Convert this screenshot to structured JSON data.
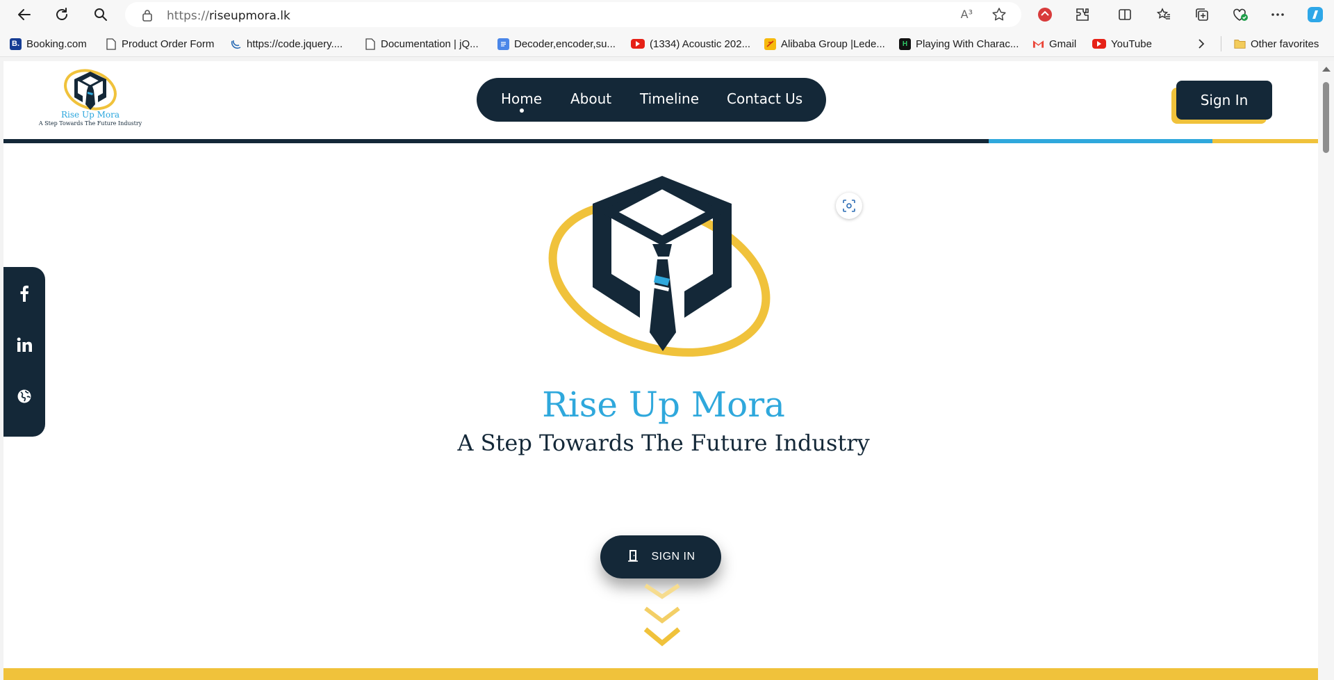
{
  "browser": {
    "url_protocol": "https://",
    "url_host": "riseupmora.lk",
    "read_aloud_label": "A³",
    "bookmarks": [
      {
        "label": "Booking.com",
        "icon": "booking-icon"
      },
      {
        "label": "Product Order Form",
        "icon": "page-icon"
      },
      {
        "label": "https://code.jquery....",
        "icon": "jquery-icon"
      },
      {
        "label": "Documentation | jQ...",
        "icon": "page-icon"
      },
      {
        "label": "Decoder,encoder,su...",
        "icon": "docs-icon"
      },
      {
        "label": "(1334) Acoustic 202...",
        "icon": "youtube-icon"
      },
      {
        "label": "Alibaba Group |Lede...",
        "icon": "alibaba-icon"
      },
      {
        "label": "Playing With Charac...",
        "icon": "hackerrank-icon"
      },
      {
        "label": "Gmail",
        "icon": "gmail-icon"
      },
      {
        "label": "YouTube",
        "icon": "youtube-icon"
      }
    ],
    "other_favorites": "Other favorites"
  },
  "site": {
    "logo_name": "Rise Up Mora",
    "logo_tagline": "A Step Towards The Future Industry",
    "nav": [
      "Home",
      "About",
      "Timeline",
      "Contact Us"
    ],
    "active_nav": "Home",
    "signin_label": "Sign In",
    "hero_title": "Rise Up Mora",
    "hero_subtitle": "A Step Towards The Future Industry",
    "cta_label": "SIGN IN",
    "social": [
      "facebook-icon",
      "linkedin-icon",
      "globe-icon",
      "instagram-icon"
    ]
  },
  "colors": {
    "navy": "#142838",
    "blue": "#2fa8dc",
    "gold": "#f0c23b"
  }
}
